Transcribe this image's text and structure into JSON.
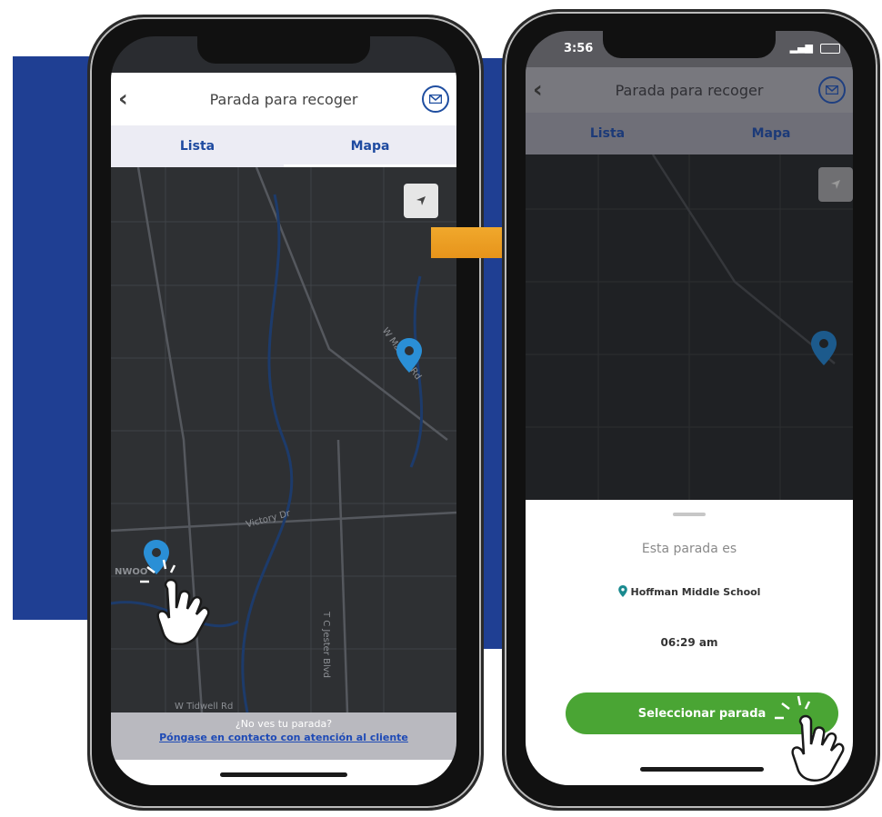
{
  "left_phone": {
    "header": {
      "title": "Parada para recoger"
    },
    "tabs": [
      {
        "label": "Lista"
      },
      {
        "label": "Mapa"
      }
    ],
    "map_labels": {
      "street_a": "W Main St Rd",
      "street_b": "Victory Dr",
      "street_c": "T C Jester Blvd",
      "street_d": "W Tidwell Rd",
      "area": "NWOO"
    },
    "footer": {
      "question": "¿No ves tu parada?",
      "link": "Póngase en contacto con atención al cliente"
    }
  },
  "right_phone": {
    "status": {
      "time": "3:56"
    },
    "header": {
      "title": "Parada para recoger"
    },
    "tabs": [
      {
        "label": "Lista"
      },
      {
        "label": "Mapa"
      }
    ],
    "sheet": {
      "heading": "Esta parada es",
      "stop_name": "Hoffman Middle School",
      "time": "06:29 am",
      "button_label": "Seleccionar parada"
    }
  },
  "colors": {
    "brand_blue": "#1f4ea0",
    "pin_blue": "#2a8fd6",
    "button_green": "#4aa534",
    "arrow_orange": "#f0a020"
  },
  "icons": [
    "back-chevron-icon",
    "mail-icon",
    "locate-arrow-icon",
    "map-pin-icon",
    "tap-hand-icon",
    "arrow-right-icon"
  ]
}
